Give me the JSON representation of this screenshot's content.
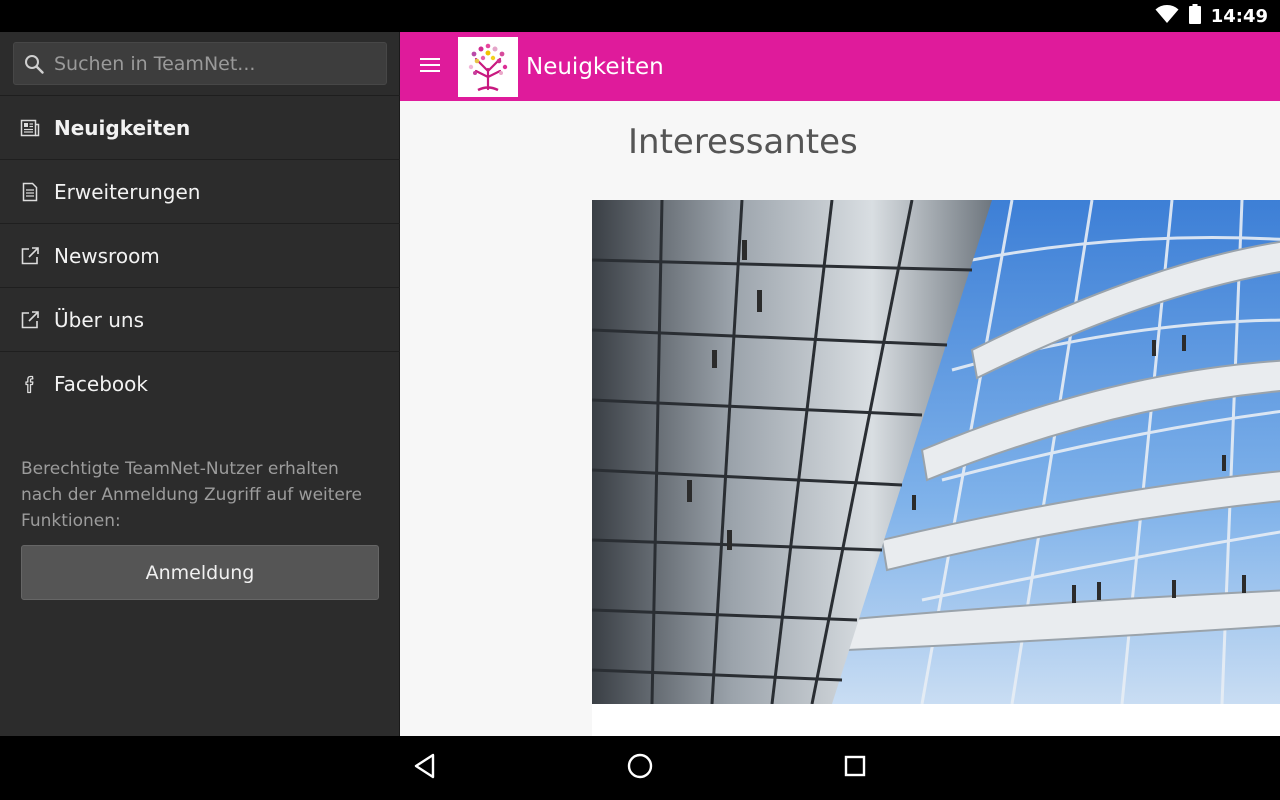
{
  "status_bar": {
    "time": "14:49"
  },
  "drawer": {
    "search": {
      "placeholder": "Suchen in TeamNet..."
    },
    "items": [
      {
        "label": "Neuigkeiten",
        "icon": "newspaper-icon",
        "active": true
      },
      {
        "label": "Erweiterungen",
        "icon": "document-icon",
        "active": false
      },
      {
        "label": "Newsroom",
        "icon": "external-link-icon",
        "active": false
      },
      {
        "label": "Über uns",
        "icon": "external-link-icon",
        "active": false
      },
      {
        "label": "Facebook",
        "icon": "facebook-icon",
        "active": false
      }
    ],
    "login_hint": "Berechtigte TeamNet-Nutzer erhalten nach der Anmeldung Zugriff auf weitere Funktionen:",
    "login_button": "Anmeldung"
  },
  "app_bar": {
    "title": "Neuigkeiten",
    "color": "#df1b9b",
    "logo": "teamnet-tree-logo"
  },
  "main": {
    "section_heading": "Interessantes",
    "article_image": "glass-dome-interior-photo"
  },
  "system_nav": {
    "back": "back-triangle-icon",
    "home": "home-circle-icon",
    "recents": "recents-square-icon"
  }
}
